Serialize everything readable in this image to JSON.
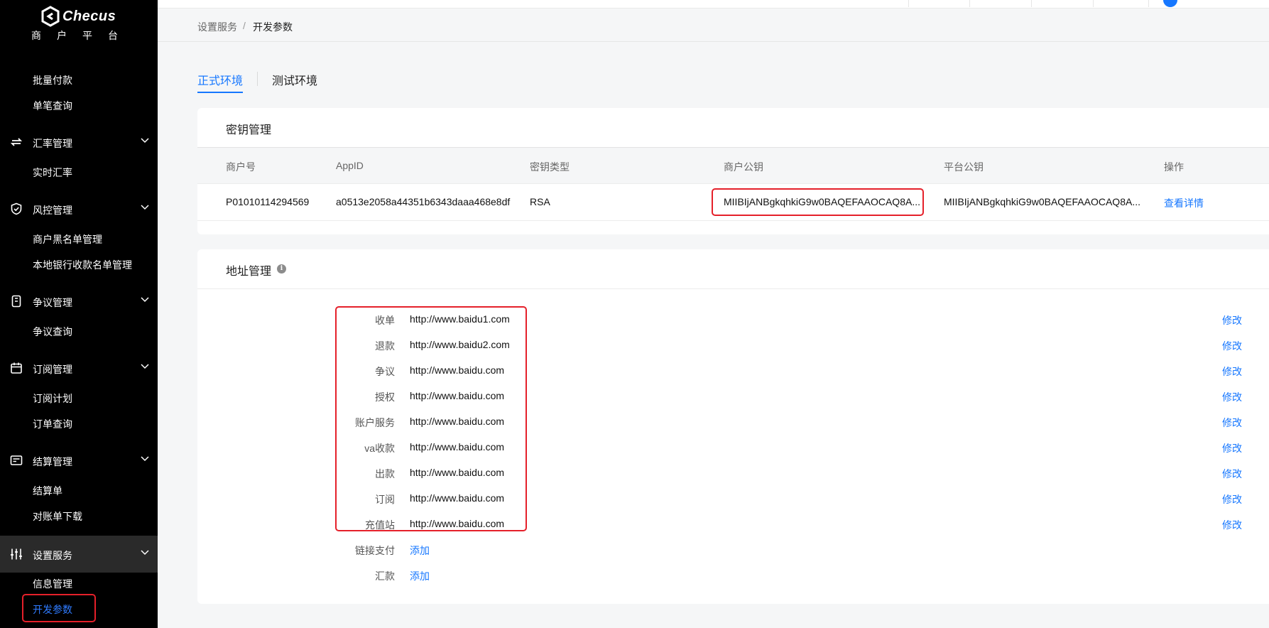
{
  "app": {
    "brand": "Checus",
    "subtitle": "商户平台"
  },
  "sidebar": {
    "items": [
      {
        "type": "sub",
        "label": "批量付款"
      },
      {
        "type": "sub",
        "label": "单笔查询"
      },
      {
        "type": "group",
        "label": "汇率管理",
        "icon": "exchange-icon"
      },
      {
        "type": "sub",
        "label": "实时汇率"
      },
      {
        "type": "group",
        "label": "风控管理",
        "icon": "shield-icon"
      },
      {
        "type": "sub",
        "label": "商户黑名单管理"
      },
      {
        "type": "sub",
        "label": "本地银行收款名单管理"
      },
      {
        "type": "group",
        "label": "争议管理",
        "icon": "dispute-icon"
      },
      {
        "type": "sub",
        "label": "争议查询"
      },
      {
        "type": "group",
        "label": "订阅管理",
        "icon": "calendar-icon"
      },
      {
        "type": "sub",
        "label": "订阅计划"
      },
      {
        "type": "sub",
        "label": "订单查询"
      },
      {
        "type": "group",
        "label": "结算管理",
        "icon": "settlement-icon"
      },
      {
        "type": "sub",
        "label": "结算单"
      },
      {
        "type": "sub",
        "label": "对账单下载"
      },
      {
        "type": "group",
        "label": "设置服务",
        "icon": "sliders-icon",
        "active": true
      },
      {
        "type": "sub",
        "label": "信息管理"
      },
      {
        "type": "sub",
        "label": "开发参数",
        "active": true
      }
    ]
  },
  "breadcrumb": {
    "parent": "设置服务",
    "separator": "/",
    "current": "开发参数"
  },
  "tabs": [
    {
      "label": "正式环境",
      "active": true
    },
    {
      "label": "测试环境",
      "active": false
    }
  ],
  "keys_card": {
    "title": "密钥管理",
    "columns": [
      "商户号",
      "AppID",
      "密钥类型",
      "商户公钥",
      "平台公钥",
      "操作"
    ],
    "rows": [
      {
        "merchant_no": "P01010114294569",
        "app_id": "a0513e2058a44351b6343daaa468e8df",
        "key_type": "RSA",
        "merchant_public_key": "MIIBIjANBgkqhkiG9w0BAQEFAAOCAQ8A...",
        "platform_public_key": "MIIBIjANBgkqhkiG9w0BAQEFAAOCAQ8A...",
        "action": "查看详情"
      }
    ]
  },
  "address_card": {
    "title": "地址管理",
    "info_icon": "info-icon",
    "edit_label": "修改",
    "add_label": "添加",
    "rows": [
      {
        "label": "收单",
        "value": "http://www.baidu1.com"
      },
      {
        "label": "退款",
        "value": "http://www.baidu2.com"
      },
      {
        "label": "争议",
        "value": "http://www.baidu.com"
      },
      {
        "label": "授权",
        "value": "http://www.baidu.com"
      },
      {
        "label": "账户服务",
        "value": "http://www.baidu.com"
      },
      {
        "label": "va收款",
        "value": "http://www.baidu.com"
      },
      {
        "label": "出款",
        "value": "http://www.baidu.com"
      },
      {
        "label": "订阅",
        "value": "http://www.baidu.com"
      },
      {
        "label": "充值站",
        "value": "http://www.baidu.com"
      }
    ],
    "empty_rows": [
      {
        "label": "链接支付"
      },
      {
        "label": "汇款"
      }
    ]
  },
  "colors": {
    "accent": "#1677ff",
    "sidebar_bg": "#000000",
    "highlight": "#e5202a"
  }
}
